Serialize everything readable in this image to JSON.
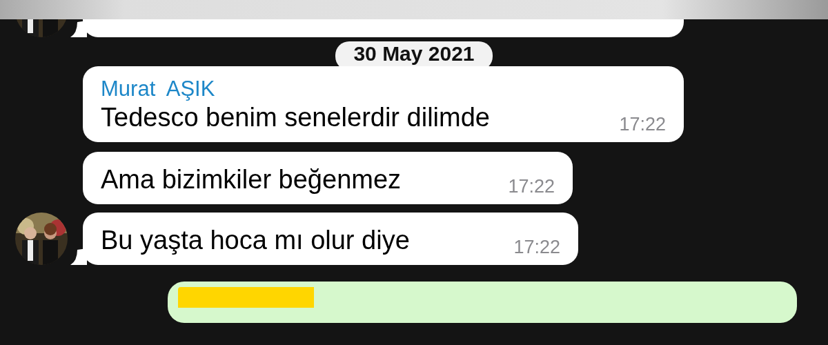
{
  "date_separator": "30 May 2021",
  "messages": [
    {
      "sender": "Murat  AŞIK",
      "text": "Tedesco benim senelerdir dilimde",
      "time": "17:22"
    },
    {
      "text": "Ama bizimkiler beğenmez",
      "time": "17:22"
    },
    {
      "text": "Bu yaşta hoca mı olur diye",
      "time": "17:22"
    }
  ]
}
